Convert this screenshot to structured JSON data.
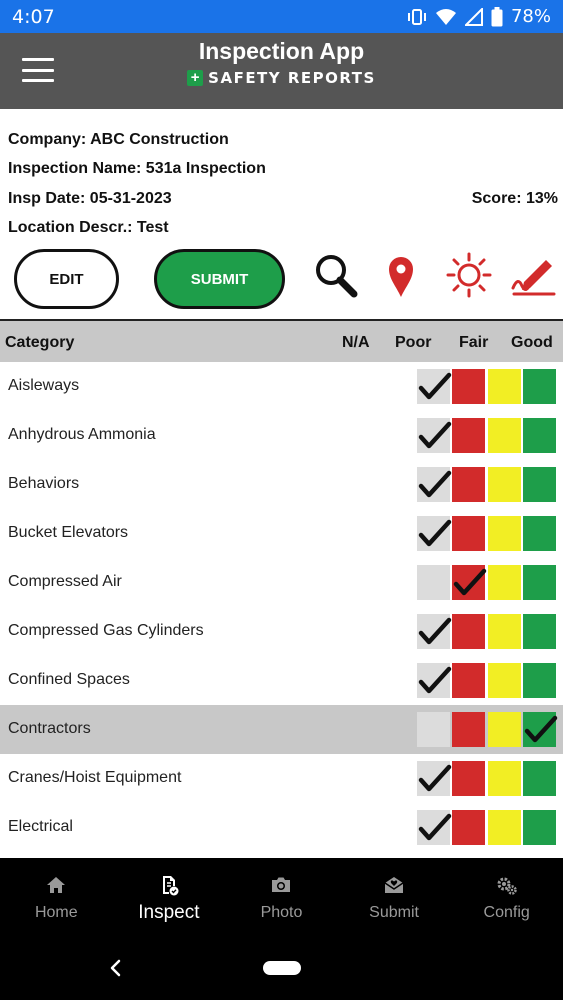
{
  "status_bar": {
    "time": "4:07",
    "battery": "78%"
  },
  "header": {
    "title": "Inspection App",
    "subtitle": "SAFETY REPORTS"
  },
  "info": {
    "company": "Company: ABC Construction",
    "inspection_name": "Inspection Name: 531a Inspection",
    "insp_date": "Insp Date: 05-31-2023",
    "score": "Score: 13%",
    "location": "Location Descr.: Test"
  },
  "actions": {
    "edit_label": "EDIT",
    "submit_label": "SUBMIT"
  },
  "tools": [
    "search-icon",
    "location-pin-icon",
    "sun-icon",
    "signature-icon"
  ],
  "colors": {
    "status_bar": "#1a73e8",
    "header": "#555555",
    "submit": "#1e9e4a",
    "poor": "#d22b2b",
    "fair": "#f2ee24",
    "good": "#1e9e4a",
    "na": "#dcdcdc",
    "accent_red": "#d22b2b"
  },
  "table": {
    "headers": {
      "category": "Category",
      "na": "N/A",
      "poor": "Poor",
      "fair": "Fair",
      "good": "Good"
    },
    "rows": [
      {
        "label": "Aisleways",
        "rating": "na"
      },
      {
        "label": "Anhydrous Ammonia",
        "rating": "na"
      },
      {
        "label": "Behaviors",
        "rating": "na"
      },
      {
        "label": "Bucket Elevators",
        "rating": "na"
      },
      {
        "label": "Compressed Air",
        "rating": "poor"
      },
      {
        "label": "Compressed Gas Cylinders",
        "rating": "na"
      },
      {
        "label": "Confined Spaces",
        "rating": "na"
      },
      {
        "label": "Contractors",
        "rating": "good",
        "selected": true
      },
      {
        "label": "Cranes/Hoist Equipment",
        "rating": "na"
      },
      {
        "label": "Electrical",
        "rating": "na"
      }
    ]
  },
  "bottom_nav": [
    {
      "label": "Home",
      "icon": "home-icon",
      "active": false
    },
    {
      "label": "Inspect",
      "icon": "inspect-icon",
      "active": true
    },
    {
      "label": "Photo",
      "icon": "camera-icon",
      "active": false
    },
    {
      "label": "Submit",
      "icon": "submit-icon",
      "active": false
    },
    {
      "label": "Config",
      "icon": "gears-icon",
      "active": false
    }
  ]
}
